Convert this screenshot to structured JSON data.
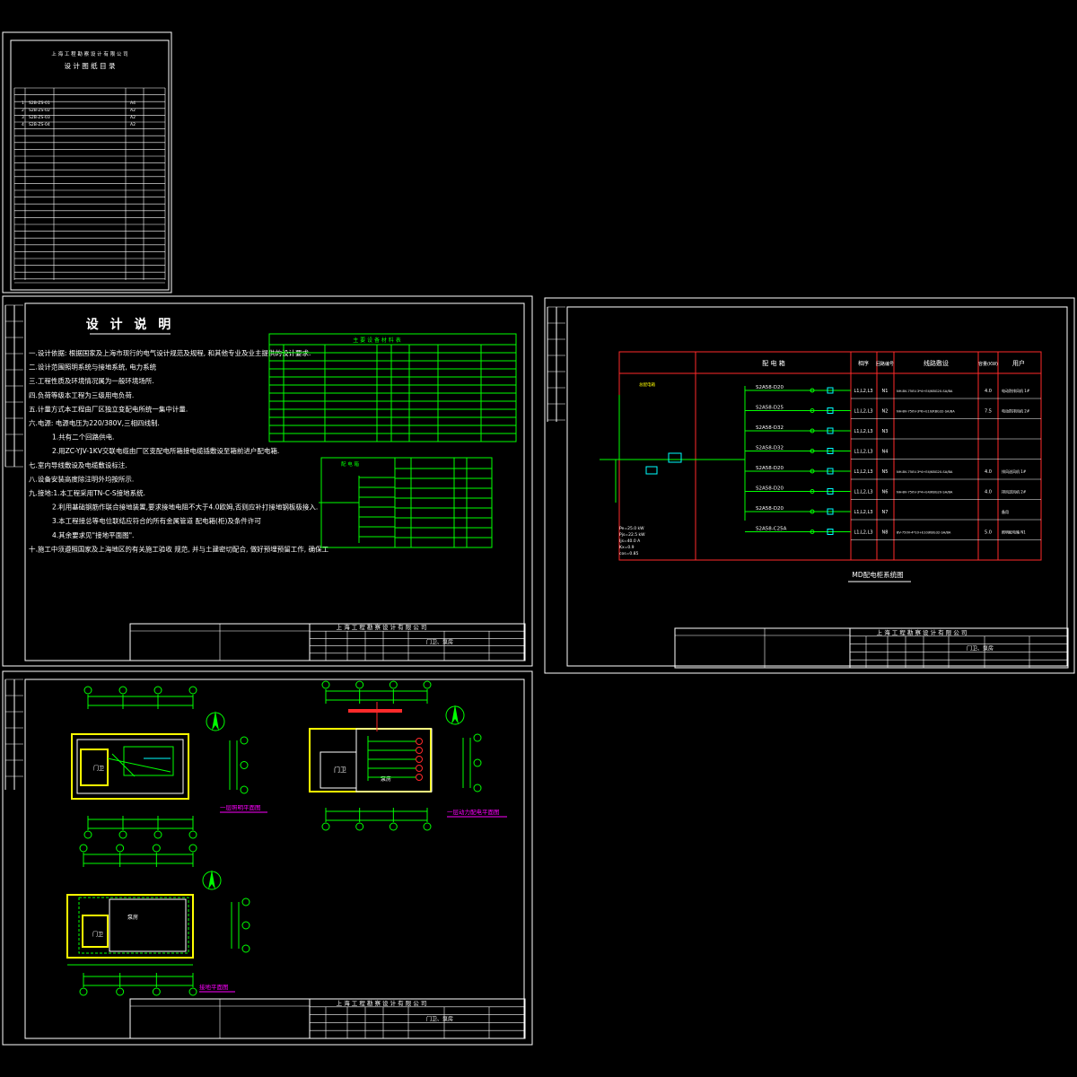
{
  "catalog_sheet": {
    "company": "上 海 工 程 勘 察 设 计 有 限 公 司",
    "title": "设 计 图 纸 目 录",
    "rows": [
      "S2B-ZS-01",
      "S2B-ZS-02",
      "S2B-ZS-03",
      "S2B-ZS-04"
    ],
    "sizes": [
      "A4",
      "A2",
      "A2",
      "A2"
    ]
  },
  "notes_sheet": {
    "title": "设 计 说 明",
    "lines": [
      "一.设计依据: 根据国家及上海市现行的电气设计规范及规程, 和其他专业及业主提供的设计要求.",
      "二.设计范围照明系统与接地系统, 电力系统",
      "三.工程性质及环境情况属为一般环境场所.",
      "四.负荷等级本工程为三级用电负荷.",
      "五.计量方式本工程由厂区独立变配电所统一集中计量.",
      "六.电源: 电源电压为220/380V,三相四线制.",
      "1.共有二个回路供电.",
      "2.用ZC-YJV-1KV交联电缆由厂区变配电所箱接电缆插敷设至箱前进户配电箱.",
      "七.室内导线敷设及电缆敷设标注.",
      "八.设备安装高度除注明外均按所示.",
      "九.接地:1.本工程采用TN-C-S接地系统.",
      "2.利用基础钢筋作联合接地装置,要求接地电阻不大于4.0欧姆,否则应补打接地钢板极接入.",
      "3.本工程接总等电位联结应符合的所有金属管道 配电箱(柜)及条件许可",
      "4.其余要求见\"接地平面图\".",
      "十.施工中须遵照国家及上海地区的有关施工验收 规范, 并与土建密切配合, 做好预埋预留工作, 确保工"
    ],
    "legend_title": "主 要 设 备 材 料 表",
    "dist_title": "配 电 箱"
  },
  "system_sheet": {
    "col_headers": [
      "配 电 箱",
      "相序",
      "回路编号",
      "线路敷设",
      "容量(KW)",
      "用户"
    ],
    "circuits": [
      {
        "breaker": "S2A58-D20",
        "phase": "L1,L2,L3",
        "no": "N1",
        "wire": "NH-BV-750V-3*4+E4/KBG20-SA/BA",
        "kw": "4.0",
        "user": "电动防排风机 1#"
      },
      {
        "breaker": "S2A58-D25",
        "phase": "L1,L2,L3",
        "no": "N2",
        "wire": "NH-BV-750V-3*6+E10/KBG32-SA/BA",
        "kw": "7.5",
        "user": "电动防排风机 2#"
      },
      {
        "breaker": "S2A58-D32",
        "phase": "L1,L2,L3",
        "no": "N3",
        "wire": "",
        "kw": "",
        "user": ""
      },
      {
        "breaker": "S2A58-D32",
        "phase": "L1,L2,L3",
        "no": "N4",
        "wire": "",
        "kw": "",
        "user": ""
      },
      {
        "breaker": "S2A58-D20",
        "phase": "L1,L2,L3",
        "no": "N5",
        "wire": "NH-BV-750V-3*4+E4/KBG20-SA/BA",
        "kw": "4.0",
        "user": "排风送风机 1#"
      },
      {
        "breaker": "S2A58-D20",
        "phase": "L1,L2,L3",
        "no": "N6",
        "wire": "NH-BV-750V-3*4+E4/KBG20-SA/BA",
        "kw": "4.0",
        "user": "排风送风机 2#"
      },
      {
        "breaker": "S2A58-D20",
        "phase": "L1,L2,L3",
        "no": "N7",
        "wire": "",
        "kw": "",
        "user": "备用"
      },
      {
        "breaker": "S2A58-C25A",
        "phase": "L1,L2,L3",
        "no": "N8",
        "wire": "BV-750V-4*10+E10/KBG32-SA/BA",
        "kw": "5.0",
        "user": "照明配电箱 N1"
      }
    ],
    "caption": "MD配电柜系统图"
  },
  "plans_sheet": {
    "caption1": "一层照明平面图",
    "caption2": "一层动力配电平面图",
    "caption3": "接地平面图",
    "room_label": "门卫",
    "room2_label": "泵房"
  },
  "titleblock": {
    "company": "上 海 工 程 勘 察 设 计 有 限 公 司",
    "project": "门卫、泵房"
  },
  "colors": {
    "background": "#000000",
    "frame": "#ffffff",
    "wire": "#00ff00",
    "hatch": "#ffff00",
    "dims": "#00ff00",
    "system_frame": "#ff2a2a",
    "caption": "#ff00ff"
  }
}
